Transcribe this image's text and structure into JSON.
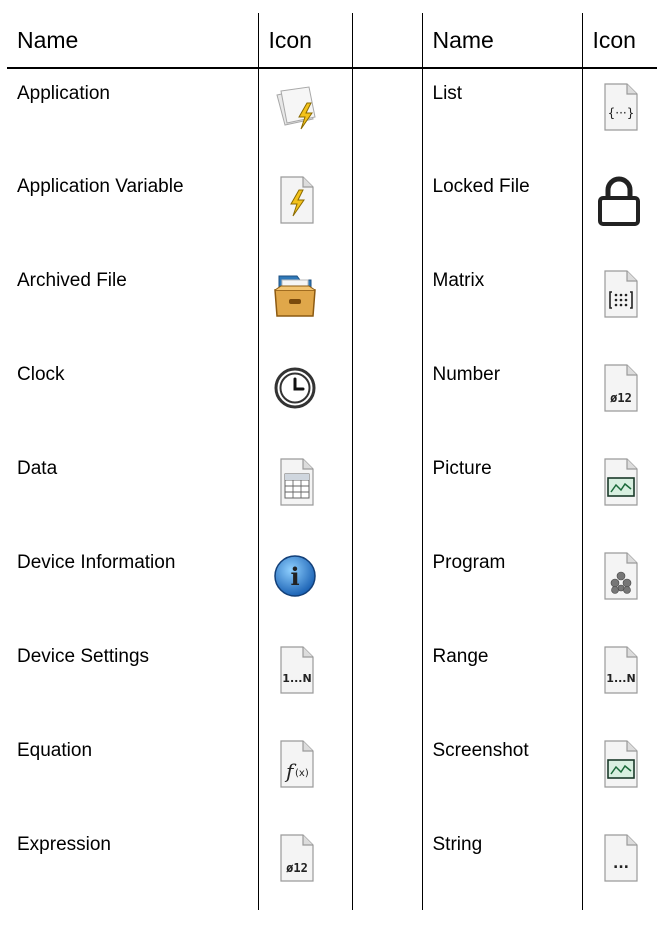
{
  "headers": {
    "name_left": "Name",
    "icon_left": "Icon",
    "name_right": "Name",
    "icon_right": "Icon"
  },
  "rows": [
    {
      "left": {
        "name": "Application",
        "icon": "application-icon"
      },
      "right": {
        "name": "List",
        "icon": "list-icon"
      }
    },
    {
      "left": {
        "name": "Application Variable",
        "icon": "application-variable-icon"
      },
      "right": {
        "name": "Locked File",
        "icon": "locked-file-icon"
      }
    },
    {
      "left": {
        "name": "Archived File",
        "icon": "archived-file-icon"
      },
      "right": {
        "name": "Matrix",
        "icon": "matrix-icon"
      }
    },
    {
      "left": {
        "name": "Clock",
        "icon": "clock-icon"
      },
      "right": {
        "name": "Number",
        "icon": "number-icon",
        "glyph": "ø12"
      }
    },
    {
      "left": {
        "name": "Data",
        "icon": "data-icon"
      },
      "right": {
        "name": "Picture",
        "icon": "picture-icon"
      }
    },
    {
      "left": {
        "name": "Device Information",
        "icon": "info-icon"
      },
      "right": {
        "name": "Program",
        "icon": "program-icon"
      }
    },
    {
      "left": {
        "name": "Device Settings",
        "icon": "device-settings-icon",
        "glyph": "1...N"
      },
      "right": {
        "name": "Range",
        "icon": "range-icon",
        "glyph": "1...N"
      }
    },
    {
      "left": {
        "name": "Equation",
        "icon": "equation-icon",
        "glyph": "f(x)"
      },
      "right": {
        "name": "Screenshot",
        "icon": "screenshot-icon"
      }
    },
    {
      "left": {
        "name": "Expression",
        "icon": "expression-icon",
        "glyph": "ø12"
      },
      "right": {
        "name": "String",
        "icon": "string-icon",
        "glyph": "..."
      }
    }
  ]
}
